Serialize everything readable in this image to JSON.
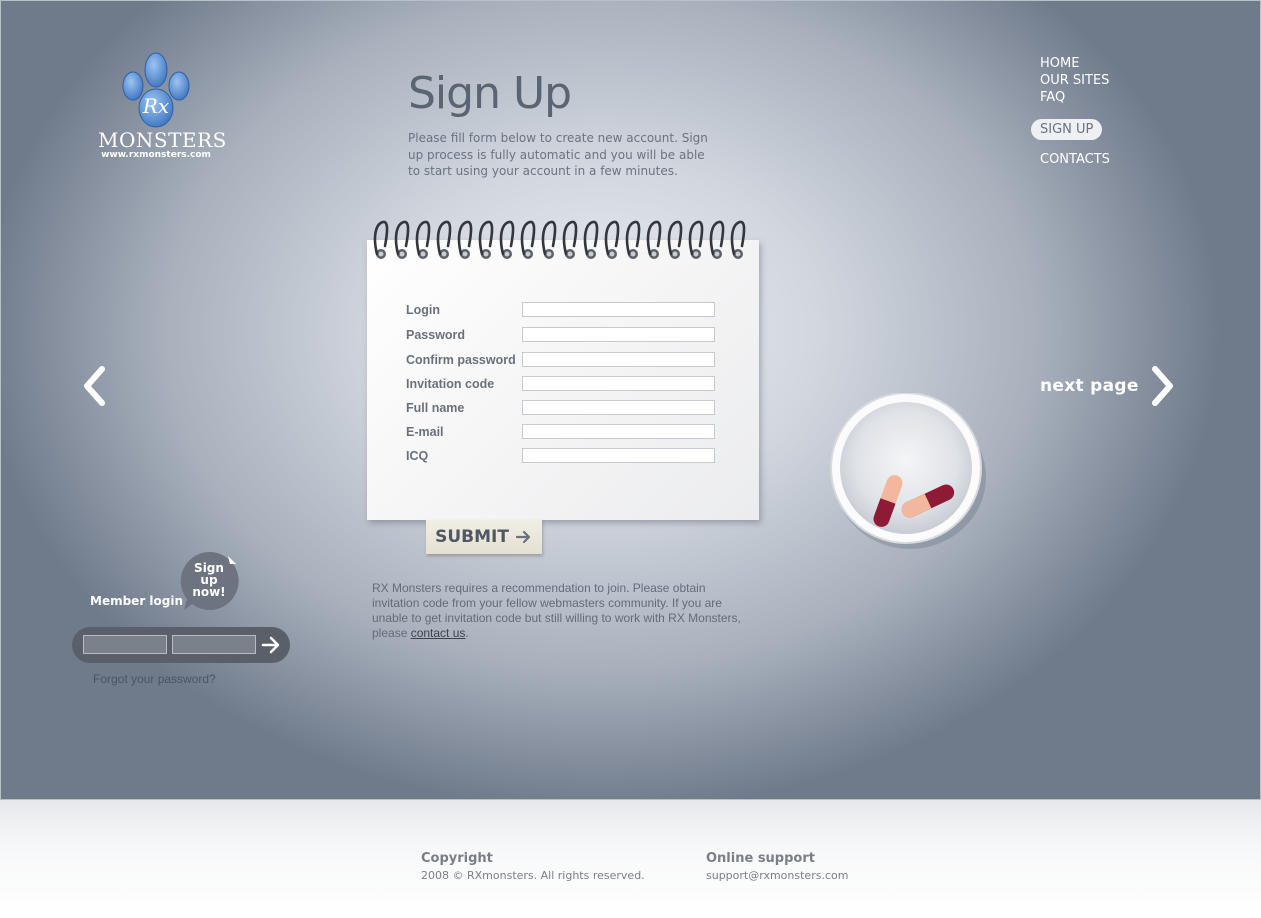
{
  "logo": {
    "mark": "Rx",
    "name": "MONSTERS",
    "url": "www.rxmonsters.com"
  },
  "page": {
    "title": "Sign Up",
    "intro": "Please fill form below to create new account. Sign up process is fully automatic and you will be able to start using your account in a few minutes."
  },
  "nav": {
    "items": [
      "HOME",
      "OUR SITES",
      "FAQ",
      "SIGN UP",
      "CONTACTS"
    ],
    "active": "SIGN UP"
  },
  "arrows": {
    "next_label": "next page",
    "prev_icon": "chevron-left-icon",
    "next_icon": "chevron-right-icon"
  },
  "form": {
    "fields": [
      {
        "label": "Login",
        "value": ""
      },
      {
        "label": "Password",
        "value": ""
      },
      {
        "label": "Confirm password",
        "value": ""
      },
      {
        "label": "Invitation code",
        "value": ""
      },
      {
        "label": "Full name",
        "value": ""
      },
      {
        "label": "E-mail",
        "value": ""
      },
      {
        "label": "ICQ",
        "value": ""
      }
    ],
    "submit_label": "SUBMIT"
  },
  "notice": {
    "text": "RX Monsters requires a recommendation to join. Please obtain invitation code from your fellow webmasters community. If you are unable to get invitation code but still willing to work with RX Monsters, please ",
    "link": "contact us",
    "end": "."
  },
  "member": {
    "label": "Member login",
    "bubble_lines": [
      "Sign",
      "up",
      "now!"
    ],
    "forgot": "Forgot your password?"
  },
  "footer": {
    "copyright_heading": "Copyright",
    "copyright_text": "2008 © RXmonsters. All rights reserved.",
    "support_heading": "Online support",
    "support_email": "support@rxmonsters.com"
  },
  "colors": {
    "accent_blue": "#4a7fc8",
    "pill_red": "#8e1a36",
    "pill_peach": "#f2b79c",
    "text_gray": "#6a717c"
  }
}
